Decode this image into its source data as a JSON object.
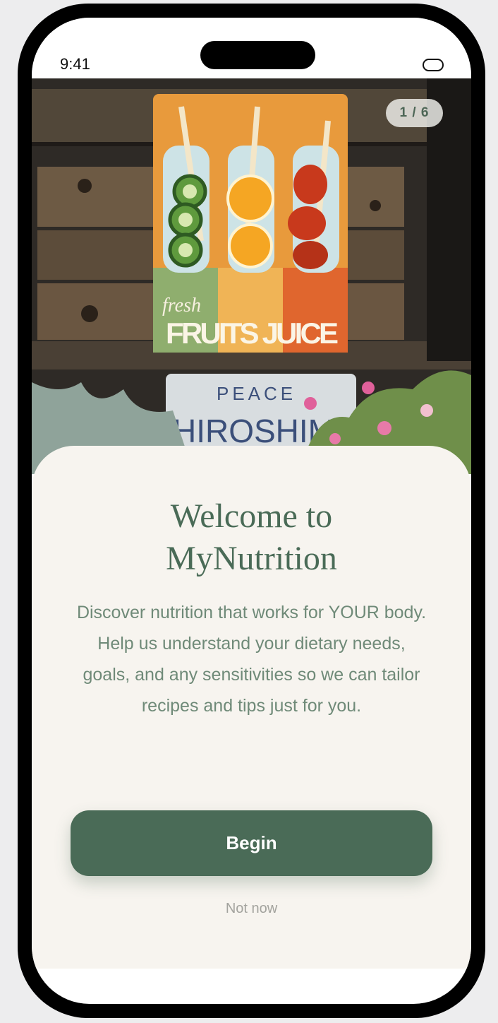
{
  "status_bar": {
    "time": "9:41"
  },
  "hero": {
    "counter": "1 / 6",
    "poster_script": "fresh",
    "poster_title": "FRUITS JUICE",
    "plate_top": "PEACE",
    "plate_bottom": "HIROSHIMA"
  },
  "welcome": {
    "title_line1": "Welcome to",
    "title_line2": "MyNutrition",
    "description": "Discover nutrition that works for YOUR body. Help us understand your dietary needs, goals, and any sensitivities so we can tailor recipes and tips just for you.",
    "begin_label": "Begin",
    "skip_label": "Not now"
  },
  "colors": {
    "accent": "#4a6b57",
    "card_bg": "#f7f4ef",
    "text_muted": "#6f8a78"
  }
}
